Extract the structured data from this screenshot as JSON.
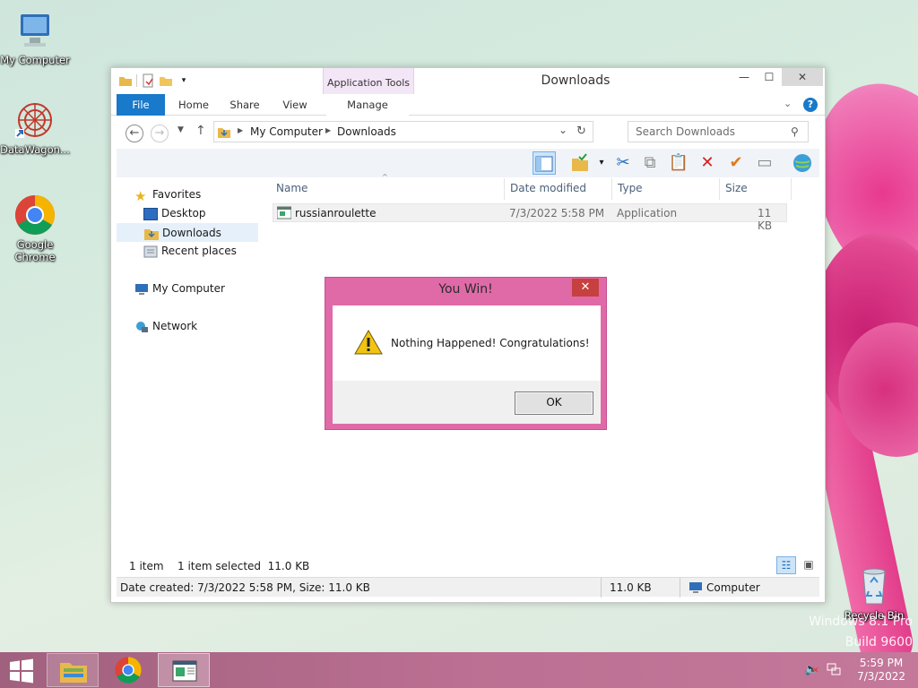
{
  "desktop": {
    "icons": [
      {
        "label": "My Computer"
      },
      {
        "label": "DataWagon..."
      },
      {
        "label": "Google Chrome"
      },
      {
        "label": "Recycle Bin"
      }
    ],
    "watermark_line1": "Windows 8.1 Pro",
    "watermark_line2": "Build 9600"
  },
  "explorer": {
    "title": "Downloads",
    "contextual_tab_group": "Application Tools",
    "tabs": [
      "File",
      "Home",
      "Share",
      "View",
      "Manage"
    ],
    "breadcrumb": [
      "My Computer",
      "Downloads"
    ],
    "search_placeholder": "Search Downloads",
    "nav": {
      "favorites": "Favorites",
      "desktop": "Desktop",
      "downloads": "Downloads",
      "recent": "Recent places",
      "computer": "My Computer",
      "network": "Network"
    },
    "columns": [
      "Name",
      "Date modified",
      "Type",
      "Size"
    ],
    "files": [
      {
        "name": "russianroulette",
        "date": "7/3/2022 5:58 PM",
        "type": "Application",
        "size": "11 KB"
      }
    ],
    "status": {
      "items": "1 item",
      "selected": "1 item selected  11.0 KB"
    },
    "details_bar": {
      "info": "Date created: 7/3/2022 5:58 PM, Size: 11.0 KB",
      "size": "11.0 KB",
      "location": "Computer"
    }
  },
  "dialog": {
    "title": "You Win!",
    "message": "Nothing Happened! Congratulations!",
    "ok_label": "OK"
  },
  "taskbar": {
    "time": "5:59 PM",
    "date": "7/3/2022"
  },
  "colors": {
    "accent": "#1979ca",
    "dialog_frame": "#e06aa8",
    "taskbar": "#b56d8f"
  }
}
